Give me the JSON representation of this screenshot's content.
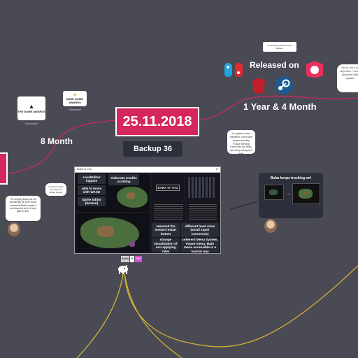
{
  "milestone": {
    "date": "25.11.2018",
    "backup": "Backup 36"
  },
  "durations": {
    "left": "8 Month",
    "right": "1 Year & 4 Month"
  },
  "release": {
    "heading": "Released on",
    "platforms": [
      "nintendo-switch-icon",
      "itch-io-icon",
      "steam-icon",
      "game-jolt-icon"
    ]
  },
  "awards": [
    {
      "logo_text": "THE GAME AWARDS",
      "caption": "Nominated"
    },
    {
      "logo_text": "INDIE GAME AWARDS",
      "caption": "Nominated"
    }
  ],
  "bubbles": {
    "switch_note": "Oh no, but it was only been 7 months since the Switch update...",
    "middle_quote": "I've gotten some weekend. Short and simple actually. Follow Sterling Fenn/Geo for Boss, and keep it support! Wait.",
    "left_quote": "I would it to take care after the middle though.",
    "avatar_quote": "The shaping Boba has felt surprisingly fun even at this somewhat flexible stage of development, and I'm very glad for that.",
    "top_note": "Something small about the update..."
  },
  "trucking": {
    "caption": "Boba keeps trucking on!"
  },
  "window": {
    "title": "Boba is You"
  },
  "notes": [
    "LevelEditor ingame",
    "elaborate Credits scrolling",
    "able to move with WASD",
    "Sprite Editor (broken)",
    "removed the instant restart button",
    "different level sizes (small super concerous)",
    "strange visualization of non applying rules",
    "coherent Menu System, Pause menu, Main menu accessible in a normal way"
  ],
  "mini_title": "BABA IS YOU",
  "rule_text": {
    "noun": "BABA",
    "verb": "IS",
    "prop": "YOU"
  },
  "colors": {
    "background": "#4a4a55",
    "accent": "#d6265e",
    "path": "#d4b236",
    "panel": "#2d2f3c"
  }
}
